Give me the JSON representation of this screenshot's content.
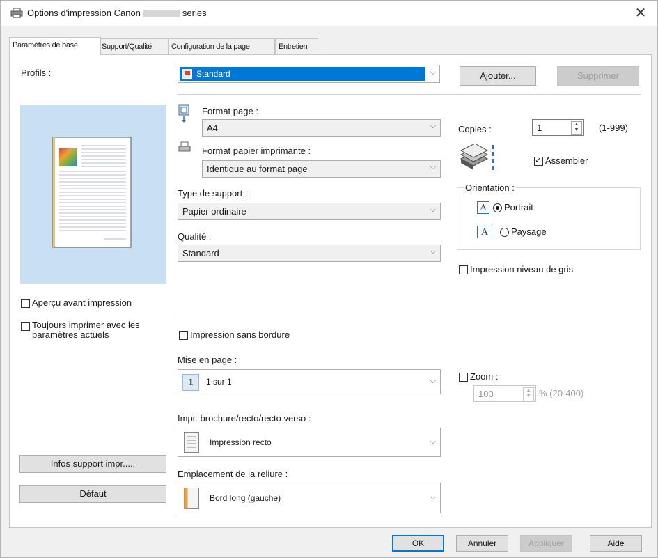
{
  "window": {
    "title_prefix": "Options d'impression Canon",
    "title_suffix": "series",
    "close": "✕"
  },
  "tabs": [
    {
      "label": "Paramètres de base",
      "active": true
    },
    {
      "label": "Support/Qualité",
      "active": false
    },
    {
      "label": "Configuration de la page",
      "active": false
    },
    {
      "label": "Entretien",
      "active": false
    }
  ],
  "profiles": {
    "label": "Profils :",
    "value": "Standard",
    "add_label": "Ajouter...",
    "delete_label": "Supprimer"
  },
  "page_format": {
    "label": "Format page :",
    "value": "A4"
  },
  "printer_paper": {
    "label": "Format papier imprimante :",
    "value": "Identique au format page"
  },
  "media_type": {
    "label": "Type de support :",
    "value": "Papier ordinaire"
  },
  "quality": {
    "label": "Qualité :",
    "value": "Standard"
  },
  "copies": {
    "label": "Copies :",
    "value": "1",
    "range": "(1-999)",
    "collate_label": "Assembler",
    "collate_checked": true
  },
  "orientation": {
    "label": "Orientation :",
    "icon_letter": "A",
    "portrait_label": "Portrait",
    "landscape_label": "Paysage",
    "selected": "portrait"
  },
  "grayscale": {
    "label": "Impression niveau de gris",
    "checked": false
  },
  "preview": {
    "label": "Aperçu avant impression",
    "checked": false
  },
  "always_print": {
    "label": "Toujours imprimer avec les paramètres actuels",
    "checked": false
  },
  "borderless": {
    "label": "Impression sans bordure",
    "checked": false
  },
  "layout": {
    "label": "Mise en page :",
    "badge": "1",
    "value": "1 sur 1"
  },
  "zoom": {
    "label": "Zoom :",
    "value": "100",
    "range": "% (20-400)",
    "checked": false
  },
  "duplex": {
    "label": "Impr. brochure/recto/recto verso :",
    "value": "Impression recto"
  },
  "binding": {
    "label": "Emplacement de la reliure :",
    "value": "Bord long (gauche)"
  },
  "left_buttons": {
    "media_info": "Infos support impr.....",
    "default": "Défaut"
  },
  "footer": {
    "ok": "OK",
    "cancel": "Annuler",
    "apply": "Appliquer",
    "help": "Aide"
  },
  "colors": {
    "selection_blue": "#0078d7",
    "preview_bg": "#c9dff3",
    "focus_border": "#0078d7"
  },
  "icons": {
    "window": "printer-icon",
    "page_format": "page-size-icon",
    "printer_paper": "paper-tray-icon",
    "copies": "collate-stack-icon",
    "duplex": "single-sided-icon",
    "binding": "binding-long-edge-icon"
  }
}
